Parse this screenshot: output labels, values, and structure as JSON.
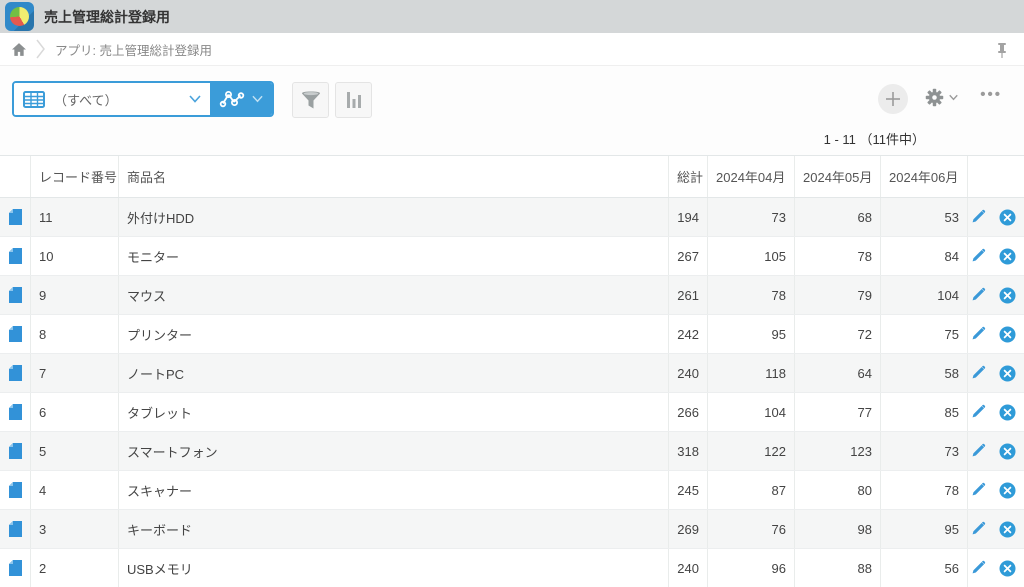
{
  "header": {
    "app_title": "売上管理総計登録用"
  },
  "breadcrumb": {
    "label": "アプリ: 売上管理総計登録用"
  },
  "toolbar": {
    "view_selector": {
      "selected_view": "（すべて）"
    },
    "icons": [
      "table-icon",
      "node-graph-icon",
      "chevron-down-icon",
      "filter-icon",
      "bar-chart-icon",
      "plus-icon",
      "gear-icon",
      "ellipsis-icon",
      "pin-icon"
    ]
  },
  "pagination": {
    "label": "1 - 11 （11件中）"
  },
  "table": {
    "columns": [
      "レコード番号",
      "商品名",
      "総計",
      "2024年04月",
      "2024年05月",
      "2024年06月"
    ],
    "rows": [
      {
        "record_no": "11",
        "product": "外付けHDD",
        "total": "194",
        "m04": "73",
        "m05": "68",
        "m06": "53"
      },
      {
        "record_no": "10",
        "product": "モニター",
        "total": "267",
        "m04": "105",
        "m05": "78",
        "m06": "84"
      },
      {
        "record_no": "9",
        "product": "マウス",
        "total": "261",
        "m04": "78",
        "m05": "79",
        "m06": "104"
      },
      {
        "record_no": "8",
        "product": "プリンター",
        "total": "242",
        "m04": "95",
        "m05": "72",
        "m06": "75"
      },
      {
        "record_no": "7",
        "product": "ノートPC",
        "total": "240",
        "m04": "118",
        "m05": "64",
        "m06": "58"
      },
      {
        "record_no": "6",
        "product": "タブレット",
        "total": "266",
        "m04": "104",
        "m05": "77",
        "m06": "85"
      },
      {
        "record_no": "5",
        "product": "スマートフォン",
        "total": "318",
        "m04": "122",
        "m05": "123",
        "m06": "73"
      },
      {
        "record_no": "4",
        "product": "スキャナー",
        "total": "245",
        "m04": "87",
        "m05": "80",
        "m06": "78"
      },
      {
        "record_no": "3",
        "product": "キーボード",
        "total": "269",
        "m04": "76",
        "m05": "98",
        "m06": "95"
      },
      {
        "record_no": "2",
        "product": "USBメモリ",
        "total": "240",
        "m04": "96",
        "m05": "88",
        "m06": "56"
      }
    ]
  },
  "colors": {
    "accent_blue": "#3b9cd9",
    "topbar_bg": "#d4d7d8",
    "zebra_row": "#f5f6f6",
    "icon_blue": "#3292d8",
    "pie_green": "#72bf44",
    "pie_yellow": "#f1ee71",
    "pie_red": "#e4594e"
  }
}
